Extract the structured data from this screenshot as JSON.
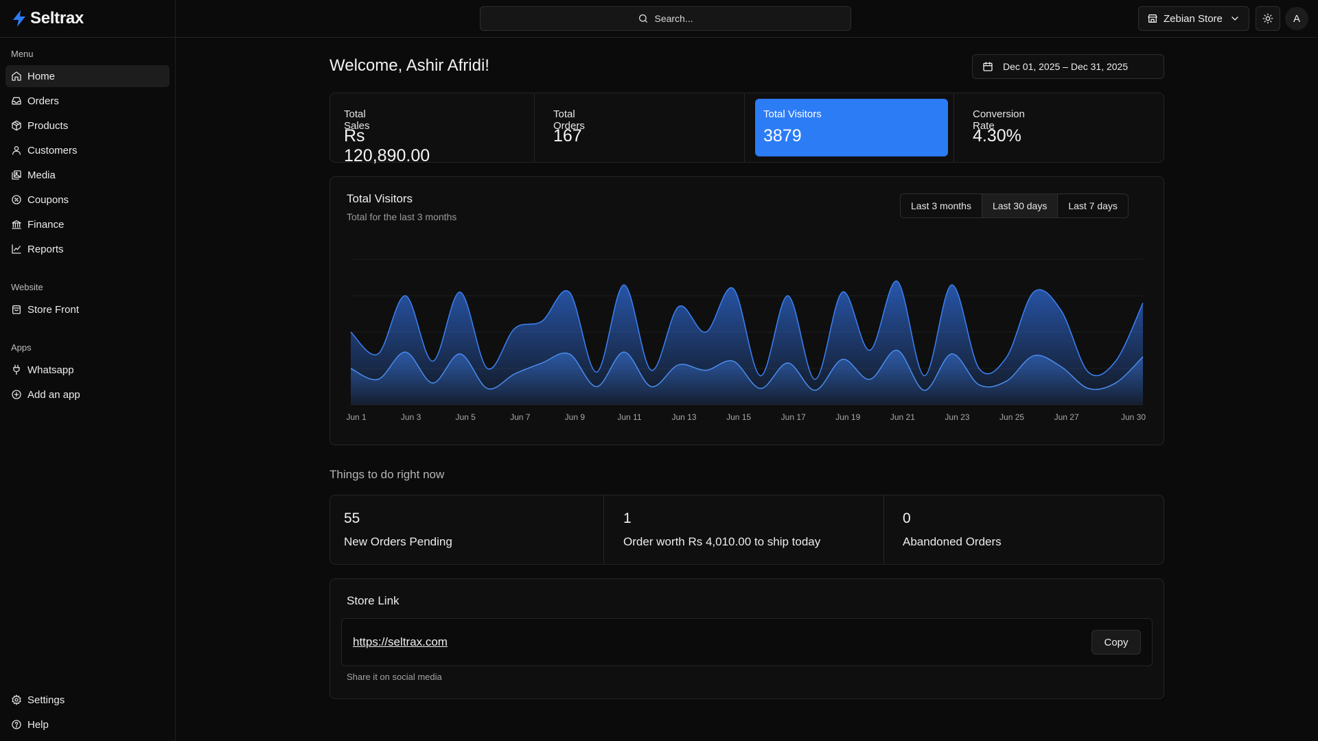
{
  "brand": {
    "name": "Seltrax",
    "icon": "bolt-icon",
    "accent": "#2c7cf6"
  },
  "header": {
    "search_label": "Search...",
    "store_name": "Zebian Store",
    "avatar_initial": "A"
  },
  "sidebar": {
    "groups": [
      {
        "label": "Menu",
        "items": [
          {
            "label": "Home",
            "icon": "home-icon",
            "active": true
          },
          {
            "label": "Orders",
            "icon": "inbox-icon"
          },
          {
            "label": "Products",
            "icon": "package-icon"
          },
          {
            "label": "Customers",
            "icon": "user-icon"
          },
          {
            "label": "Media",
            "icon": "images-icon"
          },
          {
            "label": "Coupons",
            "icon": "badge-percent-icon"
          },
          {
            "label": "Finance",
            "icon": "bank-icon"
          },
          {
            "label": "Reports",
            "icon": "line-chart-icon"
          }
        ]
      },
      {
        "label": "Website",
        "items": [
          {
            "label": "Store Front",
            "icon": "storefront-icon"
          }
        ]
      },
      {
        "label": "Apps",
        "items": [
          {
            "label": "Whatsapp",
            "icon": "plug-icon"
          },
          {
            "label": "Add an app",
            "icon": "plus-circle-icon"
          }
        ]
      }
    ],
    "footer": [
      {
        "label": "Settings",
        "icon": "gear-icon"
      },
      {
        "label": "Help",
        "icon": "help-circle-icon"
      }
    ]
  },
  "main": {
    "welcome": "Welcome, Ashir Afridi!",
    "date_range": "Dec 01, 2025 – Dec 31, 2025",
    "stats": [
      {
        "label": "Total Sales",
        "value": "Rs 120,890.00"
      },
      {
        "label": "Total Orders",
        "value": "167"
      },
      {
        "label": "Total Visitors",
        "value": "3879",
        "highlight": true
      },
      {
        "label": "Conversion Rate",
        "value": "4.30%"
      }
    ],
    "chart_card": {
      "title": "Total Visitors",
      "subtitle": "Total for the last 3 months",
      "ranges": [
        "Last 3 months",
        "Last 30 days",
        "Last 7 days"
      ],
      "active_range": "Last 30 days"
    },
    "todo": {
      "heading": "Things to do right now",
      "items": [
        {
          "count": "55",
          "label": "New Orders Pending"
        },
        {
          "count": "1",
          "label": "Order worth Rs 4,010.00 to ship today"
        },
        {
          "count": "0",
          "label": "Abandoned Orders"
        }
      ]
    },
    "store_link": {
      "title": "Store Link",
      "url": "https://seltrax.com",
      "copy_label": "Copy",
      "note": "Share it on social media"
    }
  },
  "chart_data": {
    "type": "area",
    "x": [
      "Jun 1",
      "Jun 2",
      "Jun 3",
      "Jun 4",
      "Jun 5",
      "Jun 6",
      "Jun 7",
      "Jun 8",
      "Jun 9",
      "Jun 10",
      "Jun 11",
      "Jun 12",
      "Jun 13",
      "Jun 14",
      "Jun 15",
      "Jun 16",
      "Jun 17",
      "Jun 18",
      "Jun 19",
      "Jun 20",
      "Jun 21",
      "Jun 22",
      "Jun 23",
      "Jun 24",
      "Jun 25",
      "Jun 26",
      "Jun 27",
      "Jun 28",
      "Jun 29",
      "Jun 30"
    ],
    "tick_labels": [
      "Jun 1",
      "Jun 3",
      "Jun 5",
      "Jun 7",
      "Jun 9",
      "Jun 11",
      "Jun 13",
      "Jun 15",
      "Jun 17",
      "Jun 19",
      "Jun 21",
      "Jun 23",
      "Jun 25",
      "Jun 27",
      "Jun 30"
    ],
    "series": [
      {
        "values": [
          200,
          140,
          300,
          120,
          310,
          100,
          210,
          230,
          310,
          90,
          330,
          95,
          270,
          200,
          320,
          80,
          300,
          70,
          310,
          150,
          340,
          80,
          330,
          100,
          130,
          310,
          260,
          90,
          120,
          280
        ]
      },
      {
        "values": [
          100,
          70,
          145,
          60,
          140,
          45,
          85,
          115,
          140,
          50,
          145,
          50,
          110,
          95,
          120,
          45,
          115,
          40,
          125,
          70,
          150,
          40,
          140,
          55,
          65,
          135,
          105,
          45,
          60,
          132
        ]
      }
    ],
    "ylim": [
      0,
      400
    ],
    "grid": true,
    "legend": "none",
    "colors": [
      "#2c63c7",
      "#3a78e0"
    ]
  }
}
